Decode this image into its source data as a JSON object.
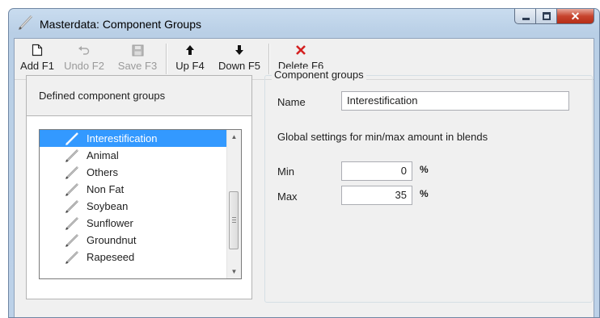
{
  "window": {
    "title": "Masterdata: Component Groups"
  },
  "toolbar": {
    "add_label": "Add F1",
    "undo_label": "Undo F2",
    "save_label": "Save F3",
    "up_label": "Up F4",
    "down_label": "Down F5",
    "delete_label": "Delete F6"
  },
  "left_panel": {
    "header": "Defined component groups",
    "items": [
      {
        "label": "Interestification",
        "selected": true
      },
      {
        "label": "Animal"
      },
      {
        "label": "Others"
      },
      {
        "label": "Non Fat"
      },
      {
        "label": "Soybean"
      },
      {
        "label": "Sunflower"
      },
      {
        "label": "Groundnut"
      },
      {
        "label": "Rapeseed"
      }
    ]
  },
  "right_panel": {
    "group_title": "Component groups",
    "name_label": "Name",
    "name_value": "Interestification",
    "settings_heading": "Global settings for min/max amount in blends",
    "min_label": "Min",
    "min_value": "0",
    "max_label": "Max",
    "max_value": "35",
    "unit": "%"
  },
  "colors": {
    "selection": "#3399ff",
    "delete_icon": "#d42020"
  },
  "icons": [
    "pen-icon",
    "new-document-icon",
    "undo-icon",
    "floppy-disk-icon",
    "arrow-up-icon",
    "arrow-down-icon",
    "delete-x-icon"
  ]
}
